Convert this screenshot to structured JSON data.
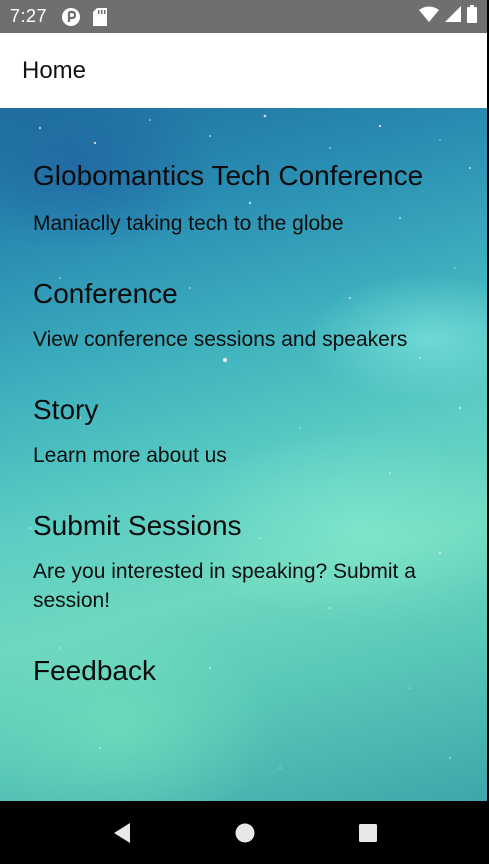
{
  "status_bar": {
    "time": "7:27",
    "icons_left": [
      "sync-badge-icon",
      "sd-card-icon"
    ],
    "icons_right": [
      "wifi-icon",
      "signal-icon",
      "battery-icon"
    ]
  },
  "app_bar": {
    "title": "Home"
  },
  "sections": [
    {
      "title": "Globomantics Tech Conference",
      "subtitle": "Maniaclly taking tech to the globe"
    },
    {
      "title": "Conference",
      "subtitle": "View conference sessions and speakers"
    },
    {
      "title": "Story",
      "subtitle": "Learn more about us"
    },
    {
      "title": "Submit Sessions",
      "subtitle": "Are you interested in speaking? Submit a session!"
    },
    {
      "title": "Feedback",
      "subtitle": ""
    }
  ],
  "nav_bar": {
    "buttons": [
      "back-icon",
      "home-icon",
      "recents-icon"
    ]
  },
  "colors": {
    "status_bar_bg": "#6f6f6f",
    "app_bar_bg": "#ffffff",
    "nav_bar_bg": "#000000"
  }
}
